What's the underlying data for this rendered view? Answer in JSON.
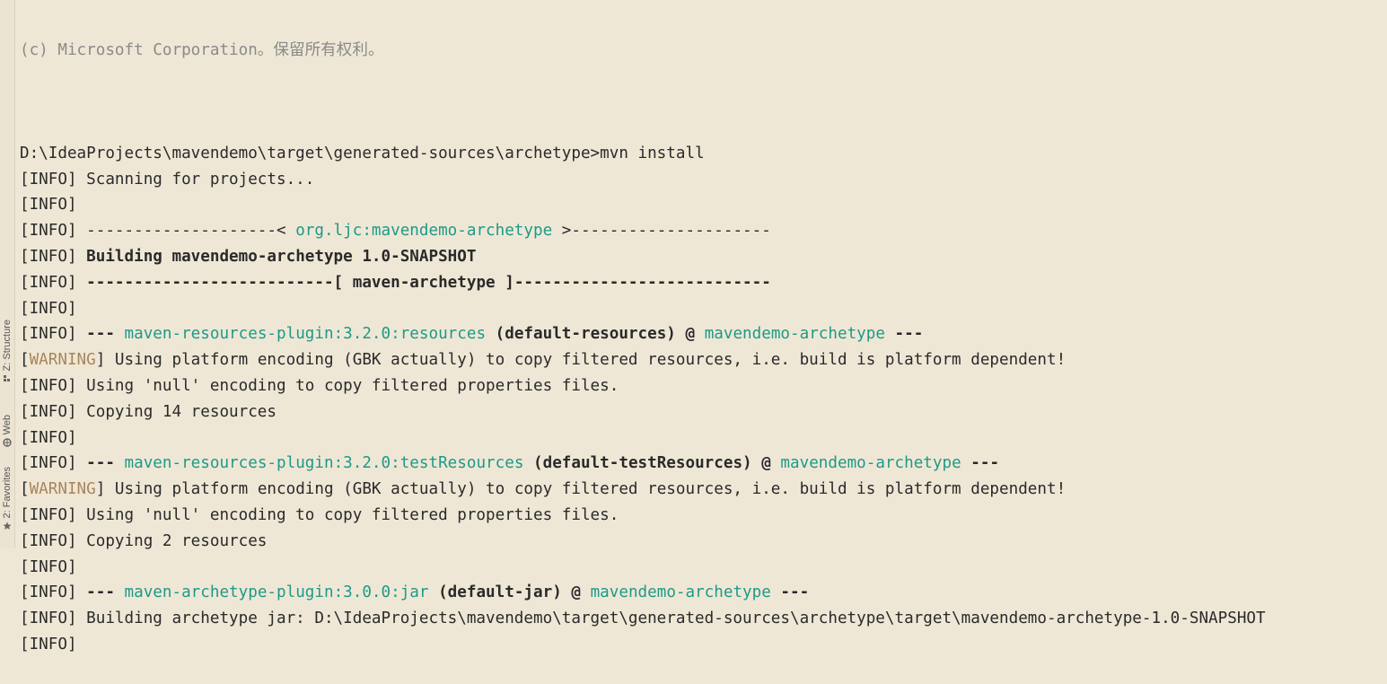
{
  "sidebar": {
    "structure_label": "Z: Structure",
    "web_label": "Web",
    "favorites_label": "2: Favorites"
  },
  "console": {
    "copyright_fragment": "(c) Microsoft Corporation。保留所有权利。",
    "lines": [
      {
        "segments": []
      },
      {
        "segments": [
          {
            "t": "D:\\IdeaProjects\\mavendemo\\target\\generated-sources\\archetype>mvn install"
          }
        ]
      },
      {
        "segments": [
          {
            "t": "[INFO] Scanning for projects..."
          }
        ]
      },
      {
        "segments": [
          {
            "t": "[INFO]"
          }
        ]
      },
      {
        "segments": [
          {
            "t": "[INFO] --------------------< "
          },
          {
            "t": "org.ljc:mavendemo-archetype",
            "s": "green"
          },
          {
            "t": " >---------------------"
          }
        ]
      },
      {
        "segments": [
          {
            "t": "[INFO] "
          },
          {
            "t": "Building mavendemo-archetype 1.0-SNAPSHOT",
            "s": "bold"
          }
        ]
      },
      {
        "segments": [
          {
            "t": "[INFO] "
          },
          {
            "t": "--------------------------[ ",
            "s": "bold"
          },
          {
            "t": "maven-archetype",
            "s": "bold"
          },
          {
            "t": " ]---------------------------",
            "s": "bold"
          }
        ]
      },
      {
        "segments": [
          {
            "t": "[INFO]"
          }
        ]
      },
      {
        "segments": [
          {
            "t": "[INFO] "
          },
          {
            "t": "--- ",
            "s": "bold"
          },
          {
            "t": "maven-resources-plugin:3.2.0:resources",
            "s": "green"
          },
          {
            "t": " (default-resources)",
            "s": "bold"
          },
          {
            "t": " @ ",
            "s": "bold"
          },
          {
            "t": "mavendemo-archetype",
            "s": "green"
          },
          {
            "t": " ---",
            "s": "bold"
          }
        ]
      },
      {
        "segments": [
          {
            "t": "["
          },
          {
            "t": "WARNING",
            "s": "warn"
          },
          {
            "t": "] Using platform encoding (GBK actually) to copy filtered resources, i.e. build is platform dependent!"
          }
        ]
      },
      {
        "segments": [
          {
            "t": "[INFO] Using 'null' encoding to copy filtered properties files."
          }
        ]
      },
      {
        "segments": [
          {
            "t": "[INFO] Copying 14 resources"
          }
        ]
      },
      {
        "segments": [
          {
            "t": "[INFO]"
          }
        ]
      },
      {
        "segments": [
          {
            "t": "[INFO] "
          },
          {
            "t": "--- ",
            "s": "bold"
          },
          {
            "t": "maven-resources-plugin:3.2.0:testResources",
            "s": "green"
          },
          {
            "t": " (default-testResources)",
            "s": "bold"
          },
          {
            "t": " @ ",
            "s": "bold"
          },
          {
            "t": "mavendemo-archetype",
            "s": "green"
          },
          {
            "t": " ---",
            "s": "bold"
          }
        ]
      },
      {
        "segments": [
          {
            "t": "["
          },
          {
            "t": "WARNING",
            "s": "warn"
          },
          {
            "t": "] Using platform encoding (GBK actually) to copy filtered resources, i.e. build is platform dependent!"
          }
        ]
      },
      {
        "segments": [
          {
            "t": "[INFO] Using 'null' encoding to copy filtered properties files."
          }
        ]
      },
      {
        "segments": [
          {
            "t": "[INFO] Copying 2 resources"
          }
        ]
      },
      {
        "segments": [
          {
            "t": "[INFO]"
          }
        ]
      },
      {
        "segments": [
          {
            "t": "[INFO] "
          },
          {
            "t": "--- ",
            "s": "bold"
          },
          {
            "t": "maven-archetype-plugin:3.0.0:jar",
            "s": "green"
          },
          {
            "t": " (default-jar)",
            "s": "bold"
          },
          {
            "t": " @ ",
            "s": "bold"
          },
          {
            "t": "mavendemo-archetype",
            "s": "green"
          },
          {
            "t": " ---",
            "s": "bold"
          }
        ]
      },
      {
        "segments": [
          {
            "t": "[INFO] Building archetype jar: D:\\IdeaProjects\\mavendemo\\target\\generated-sources\\archetype\\target\\mavendemo-archetype-1.0-SNAPSHOT"
          }
        ]
      },
      {
        "segments": [
          {
            "t": "[INFO]"
          }
        ]
      }
    ]
  }
}
